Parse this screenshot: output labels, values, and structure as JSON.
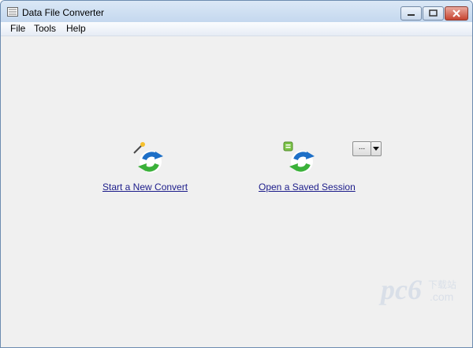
{
  "window": {
    "title": "Data File Converter"
  },
  "menu": [
    {
      "label": "File"
    },
    {
      "label": "Tools"
    },
    {
      "label": "Help"
    }
  ],
  "actions": {
    "new_convert": {
      "label": "Start a New Convert",
      "icon": "convert-wand-icon"
    },
    "open_session": {
      "label": "Open a Saved Session",
      "icon": "convert-session-icon",
      "browse_label": "...",
      "dropdown_icon": "triangle-down-icon"
    }
  },
  "watermark": {
    "text": "pc6",
    "subtext": "下载站",
    "domain": ".com"
  },
  "colors": {
    "link": "#1c1c8a",
    "window_bg": "#f0f0f0",
    "title_bar": "#c3d7ee",
    "close_button": "#c7432f",
    "icon_blue": "#1d6fc7",
    "icon_green": "#3bb13a"
  }
}
